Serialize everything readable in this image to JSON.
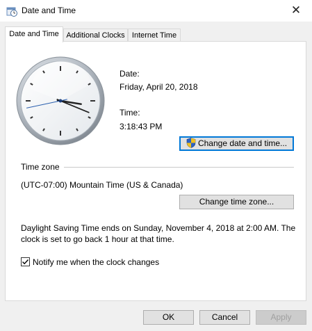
{
  "window": {
    "title": "Date and Time",
    "close_glyph": "✕",
    "icon": "clock-calendar-icon"
  },
  "tabs": [
    {
      "label": "Date and Time",
      "active": true
    },
    {
      "label": "Additional Clocks",
      "active": false
    },
    {
      "label": "Internet Time",
      "active": false
    }
  ],
  "datetime": {
    "date_label": "Date:",
    "date_value": "Friday, April 20, 2018",
    "time_label": "Time:",
    "time_value": "3:18:43 PM",
    "change_button": "Change date and time..."
  },
  "clock": {
    "hour": 3,
    "minute": 18,
    "second": 43
  },
  "timezone": {
    "heading": "Time zone",
    "value": "(UTC-07:00) Mountain Time (US & Canada)",
    "change_button": "Change time zone..."
  },
  "dst": {
    "line1": "Daylight Saving Time ends on Sunday, November 4, 2018 at 2:00 AM. The",
    "line2": "clock is set to go back 1 hour at that time."
  },
  "notify": {
    "label": "Notify me when the clock changes",
    "checked": true
  },
  "footer": {
    "ok": "OK",
    "cancel": "Cancel",
    "apply": "Apply"
  },
  "colors": {
    "accent": "#0078d7",
    "panel_bg": "#ffffff",
    "window_bg": "#f0f0f0"
  }
}
